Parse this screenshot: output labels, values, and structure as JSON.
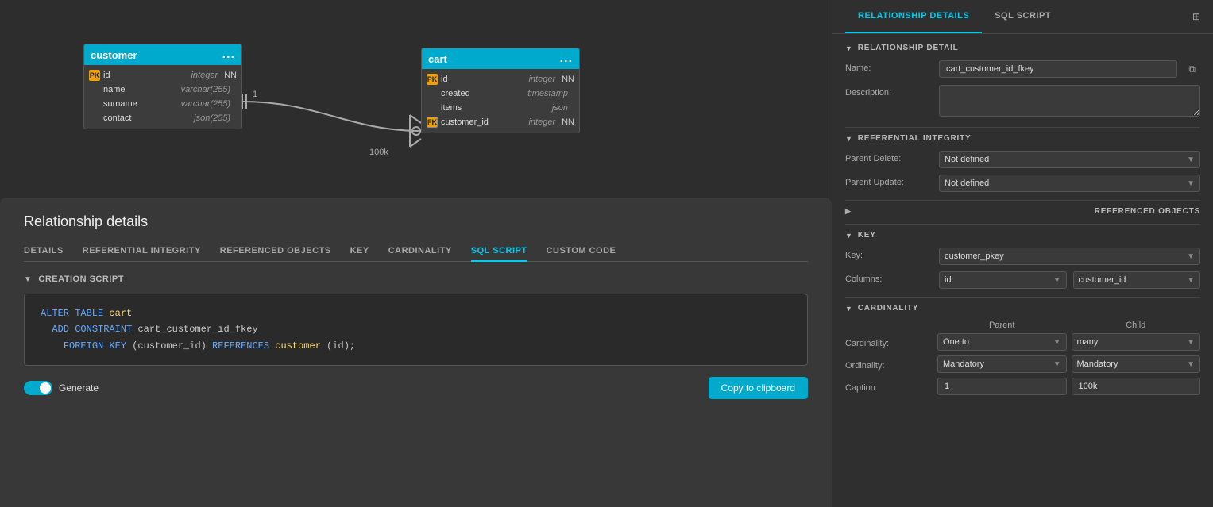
{
  "diagram": {
    "customer_table": {
      "title": "customer",
      "dots": "...",
      "columns": [
        {
          "icon": "pk-fk",
          "name": "id",
          "type": "integer",
          "nn": "NN"
        },
        {
          "icon": "",
          "name": "name",
          "type": "varchar(255)",
          "nn": ""
        },
        {
          "icon": "",
          "name": "surname",
          "type": "varchar(255)",
          "nn": ""
        },
        {
          "icon": "",
          "name": "contact",
          "type": "json(255)",
          "nn": ""
        }
      ]
    },
    "cart_table": {
      "title": "cart",
      "dots": "...",
      "columns": [
        {
          "icon": "pk",
          "name": "id",
          "type": "integer",
          "nn": "NN"
        },
        {
          "icon": "",
          "name": "created",
          "type": "timestamp",
          "nn": ""
        },
        {
          "icon": "",
          "name": "items",
          "type": "json",
          "nn": ""
        },
        {
          "icon": "fk",
          "name": "customer_id",
          "type": "integer",
          "nn": "NN"
        }
      ]
    }
  },
  "relationship_panel": {
    "title": "Relationship details",
    "tabs": [
      {
        "label": "DETAILS",
        "active": false
      },
      {
        "label": "REFERENTIAL INTEGRITY",
        "active": false
      },
      {
        "label": "REFERENCED OBJECTS",
        "active": false
      },
      {
        "label": "KEY",
        "active": false
      },
      {
        "label": "CARDINALITY",
        "active": false
      },
      {
        "label": "SQL SCRIPT",
        "active": true
      },
      {
        "label": "CUSTOM CODE",
        "active": false
      }
    ],
    "creation_script": {
      "section_label": "CREATION SCRIPT",
      "code_lines": [
        "ALTER TABLE cart",
        "  ADD CONSTRAINT cart_customer_id_fkey",
        "    FOREIGN KEY (customer_id) REFERENCES customer (id);"
      ]
    },
    "generate_label": "Generate",
    "copy_button_label": "Copy to clipboard"
  },
  "right_panel": {
    "tabs": [
      {
        "label": "RELATIONSHIP DETAILS",
        "active": true
      },
      {
        "label": "SQL SCRIPT",
        "active": false
      }
    ],
    "panel_icon": "⊞",
    "sections": {
      "relationship_detail": {
        "title": "RELATIONSHIP DETAIL",
        "name_label": "Name:",
        "name_value": "cart_customer_id_fkey",
        "description_label": "Description:",
        "description_value": ""
      },
      "referential_integrity": {
        "title": "REFERENTIAL INTEGRITY",
        "parent_delete_label": "Parent Delete:",
        "parent_delete_value": "Not defined",
        "parent_update_label": "Parent Update:",
        "parent_update_value": "Not defined"
      },
      "referenced_objects": {
        "title": "REFERENCED OBJECTS",
        "collapsed": true
      },
      "key": {
        "title": "KEY",
        "key_label": "Key:",
        "key_value": "customer_pkey",
        "columns_label": "Columns:",
        "col_left": "id",
        "col_right": "customer_id"
      },
      "cardinality": {
        "title": "CARDINALITY",
        "parent_header": "Parent",
        "child_header": "Child",
        "cardinality_label": "Cardinality:",
        "cardinality_parent": "One to",
        "cardinality_child": "many",
        "ordinality_label": "Ordinality:",
        "ordinality_parent": "Mandatory",
        "ordinality_child": "Mandatory",
        "caption_label": "Caption:",
        "caption_parent": "1",
        "caption_child": "100k"
      }
    }
  }
}
